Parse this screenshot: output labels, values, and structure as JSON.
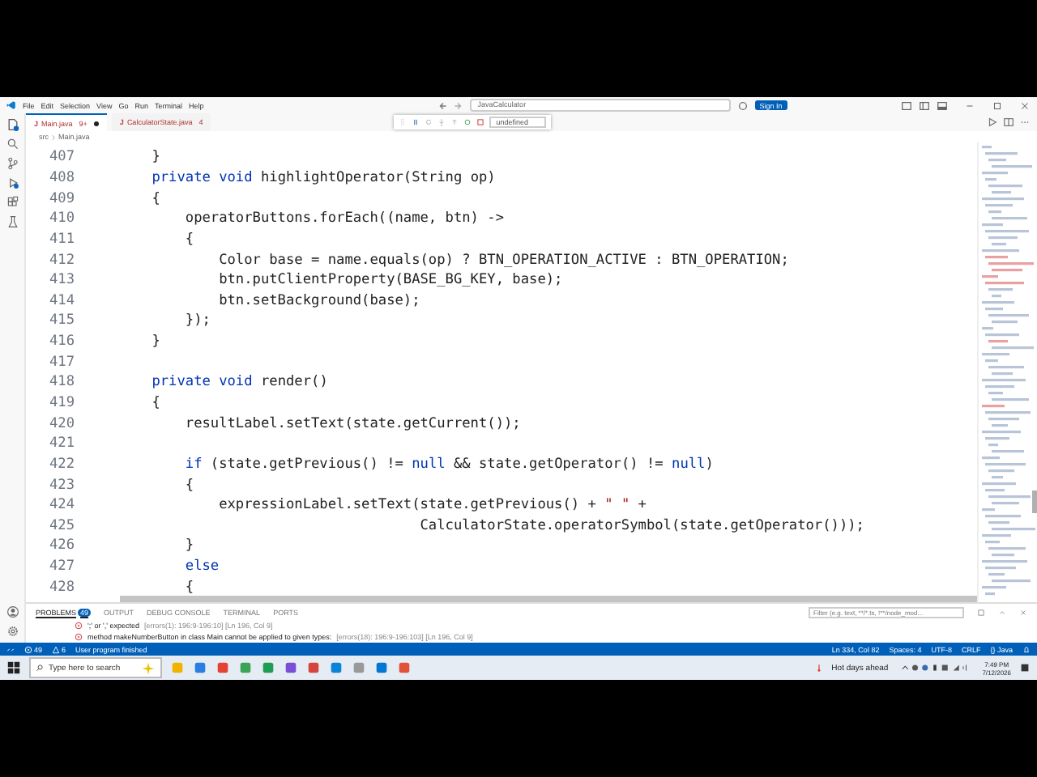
{
  "menu": [
    "File",
    "Edit",
    "Selection",
    "View",
    "Go",
    "Run",
    "Terminal",
    "Help"
  ],
  "command_center": "JavaCalculator",
  "sign_in": "Sign In",
  "debug_toolbar": {
    "config": "undefined"
  },
  "tabs": [
    {
      "icon": "J",
      "label": "Main.java",
      "badge": "9+",
      "modified": true,
      "selected": true
    },
    {
      "icon": "J",
      "label": "CalculatorState.java",
      "badge": "4",
      "modified": false,
      "selected": false
    }
  ],
  "breadcrumb": [
    "src",
    "Main.java"
  ],
  "editor": {
    "lines": [
      {
        "n": "407",
        "parts": [
          {
            "t": "    }",
            "kind": "plain"
          }
        ]
      },
      {
        "n": "408",
        "parts": [
          {
            "t": "    private void",
            "kind": "keyword"
          },
          {
            "t": " highlightOperator(String op)",
            "kind": "plain"
          }
        ]
      },
      {
        "n": "409",
        "parts": [
          {
            "t": "    {",
            "kind": "plain"
          }
        ]
      },
      {
        "n": "410",
        "parts": [
          {
            "t": "        operatorButtons.forEach((name, btn) ->",
            "kind": "plain"
          }
        ]
      },
      {
        "n": "411",
        "parts": [
          {
            "t": "        {",
            "kind": "plain"
          }
        ]
      },
      {
        "n": "412",
        "parts": [
          {
            "t": "            Color base = name.equals(op) ? BTN_OPERATION_ACTIVE : BTN_OPERATION;",
            "kind": "plain"
          }
        ]
      },
      {
        "n": "413",
        "parts": [
          {
            "t": "            btn.putClientProperty(BASE_BG_KEY, base);",
            "kind": "plain"
          }
        ]
      },
      {
        "n": "414",
        "parts": [
          {
            "t": "            btn.setBackground(base);",
            "kind": "plain"
          }
        ]
      },
      {
        "n": "415",
        "parts": [
          {
            "t": "        });",
            "kind": "plain"
          }
        ]
      },
      {
        "n": "416",
        "parts": [
          {
            "t": "    }",
            "kind": "plain"
          }
        ]
      },
      {
        "n": "417"
      },
      {
        "n": "418",
        "parts": [
          {
            "t": "    private void",
            "kind": "keyword"
          },
          {
            "t": " render()",
            "kind": "plain"
          }
        ]
      },
      {
        "n": "419",
        "parts": [
          {
            "t": "    {",
            "kind": "plain"
          }
        ]
      },
      {
        "n": "420",
        "parts": [
          {
            "t": "        resultLabel.setText(state.getCurrent());",
            "kind": "plain"
          }
        ]
      },
      {
        "n": "421"
      },
      {
        "n": "422",
        "parts": [
          {
            "t": "        if",
            "kind": "keyword"
          },
          {
            "t": " (state.getPrevious() != ",
            "kind": "plain"
          },
          {
            "t": "null",
            "kind": "keyword"
          },
          {
            "t": " && state.getOperator() != ",
            "kind": "plain"
          },
          {
            "t": "null",
            "kind": "keyword"
          },
          {
            "t": ")",
            "kind": "plain"
          }
        ]
      },
      {
        "n": "423",
        "parts": [
          {
            "t": "        {",
            "kind": "plain"
          }
        ]
      },
      {
        "n": "424",
        "parts": [
          {
            "t": "            expressionLabel.setText(state.getPrevious() + ",
            "kind": "plain"
          },
          {
            "t": "\" \"",
            "kind": "string"
          },
          {
            "t": " +",
            "kind": "plain"
          }
        ]
      },
      {
        "n": "425",
        "parts": [
          {
            "t": "                                    CalculatorState.operatorSymbol(state.getOperator()));",
            "kind": "plain"
          }
        ]
      },
      {
        "n": "426",
        "parts": [
          {
            "t": "        }",
            "kind": "plain"
          }
        ]
      },
      {
        "n": "427",
        "parts": [
          {
            "t": "        else",
            "kind": "keyword"
          }
        ]
      },
      {
        "n": "428",
        "parts": [
          {
            "t": "        {",
            "kind": "plain"
          }
        ]
      }
    ]
  },
  "panel": {
    "tabs": [
      {
        "label": "PROBLEMS",
        "badge": "49",
        "selected": true
      },
      {
        "label": "OUTPUT",
        "selected": false
      },
      {
        "label": "DEBUG CONSOLE",
        "selected": false
      },
      {
        "label": "TERMINAL",
        "selected": false
      },
      {
        "label": "PORTS",
        "selected": false
      }
    ],
    "filter": {
      "placeholder": "Filter (e.g. text, **/*.ts, !**/node_mod..."
    },
    "problems": [
      {
        "message": "';' or ',' expected",
        "detail": "[errors(1): 196:9-196:10]  [Ln 196, Col 9]"
      },
      {
        "message": "method makeNumberButton in class Main cannot be applied to given types:",
        "detail": "[errors(18): 196:9-196:103]  [Ln 196, Col 9]"
      }
    ]
  },
  "status_bar": {
    "errors": "49",
    "warnings": "6",
    "message": "User program finished",
    "items": [
      "Ln 334, Col 82",
      "Spaces: 4",
      "UTF-8",
      "CRLF",
      "{} Java"
    ]
  },
  "taskbar": {
    "search": {
      "placeholder": "Type here to search"
    },
    "weather": "Hot days ahead",
    "time": "7:49 PM",
    "date": "7/12/2026"
  }
}
